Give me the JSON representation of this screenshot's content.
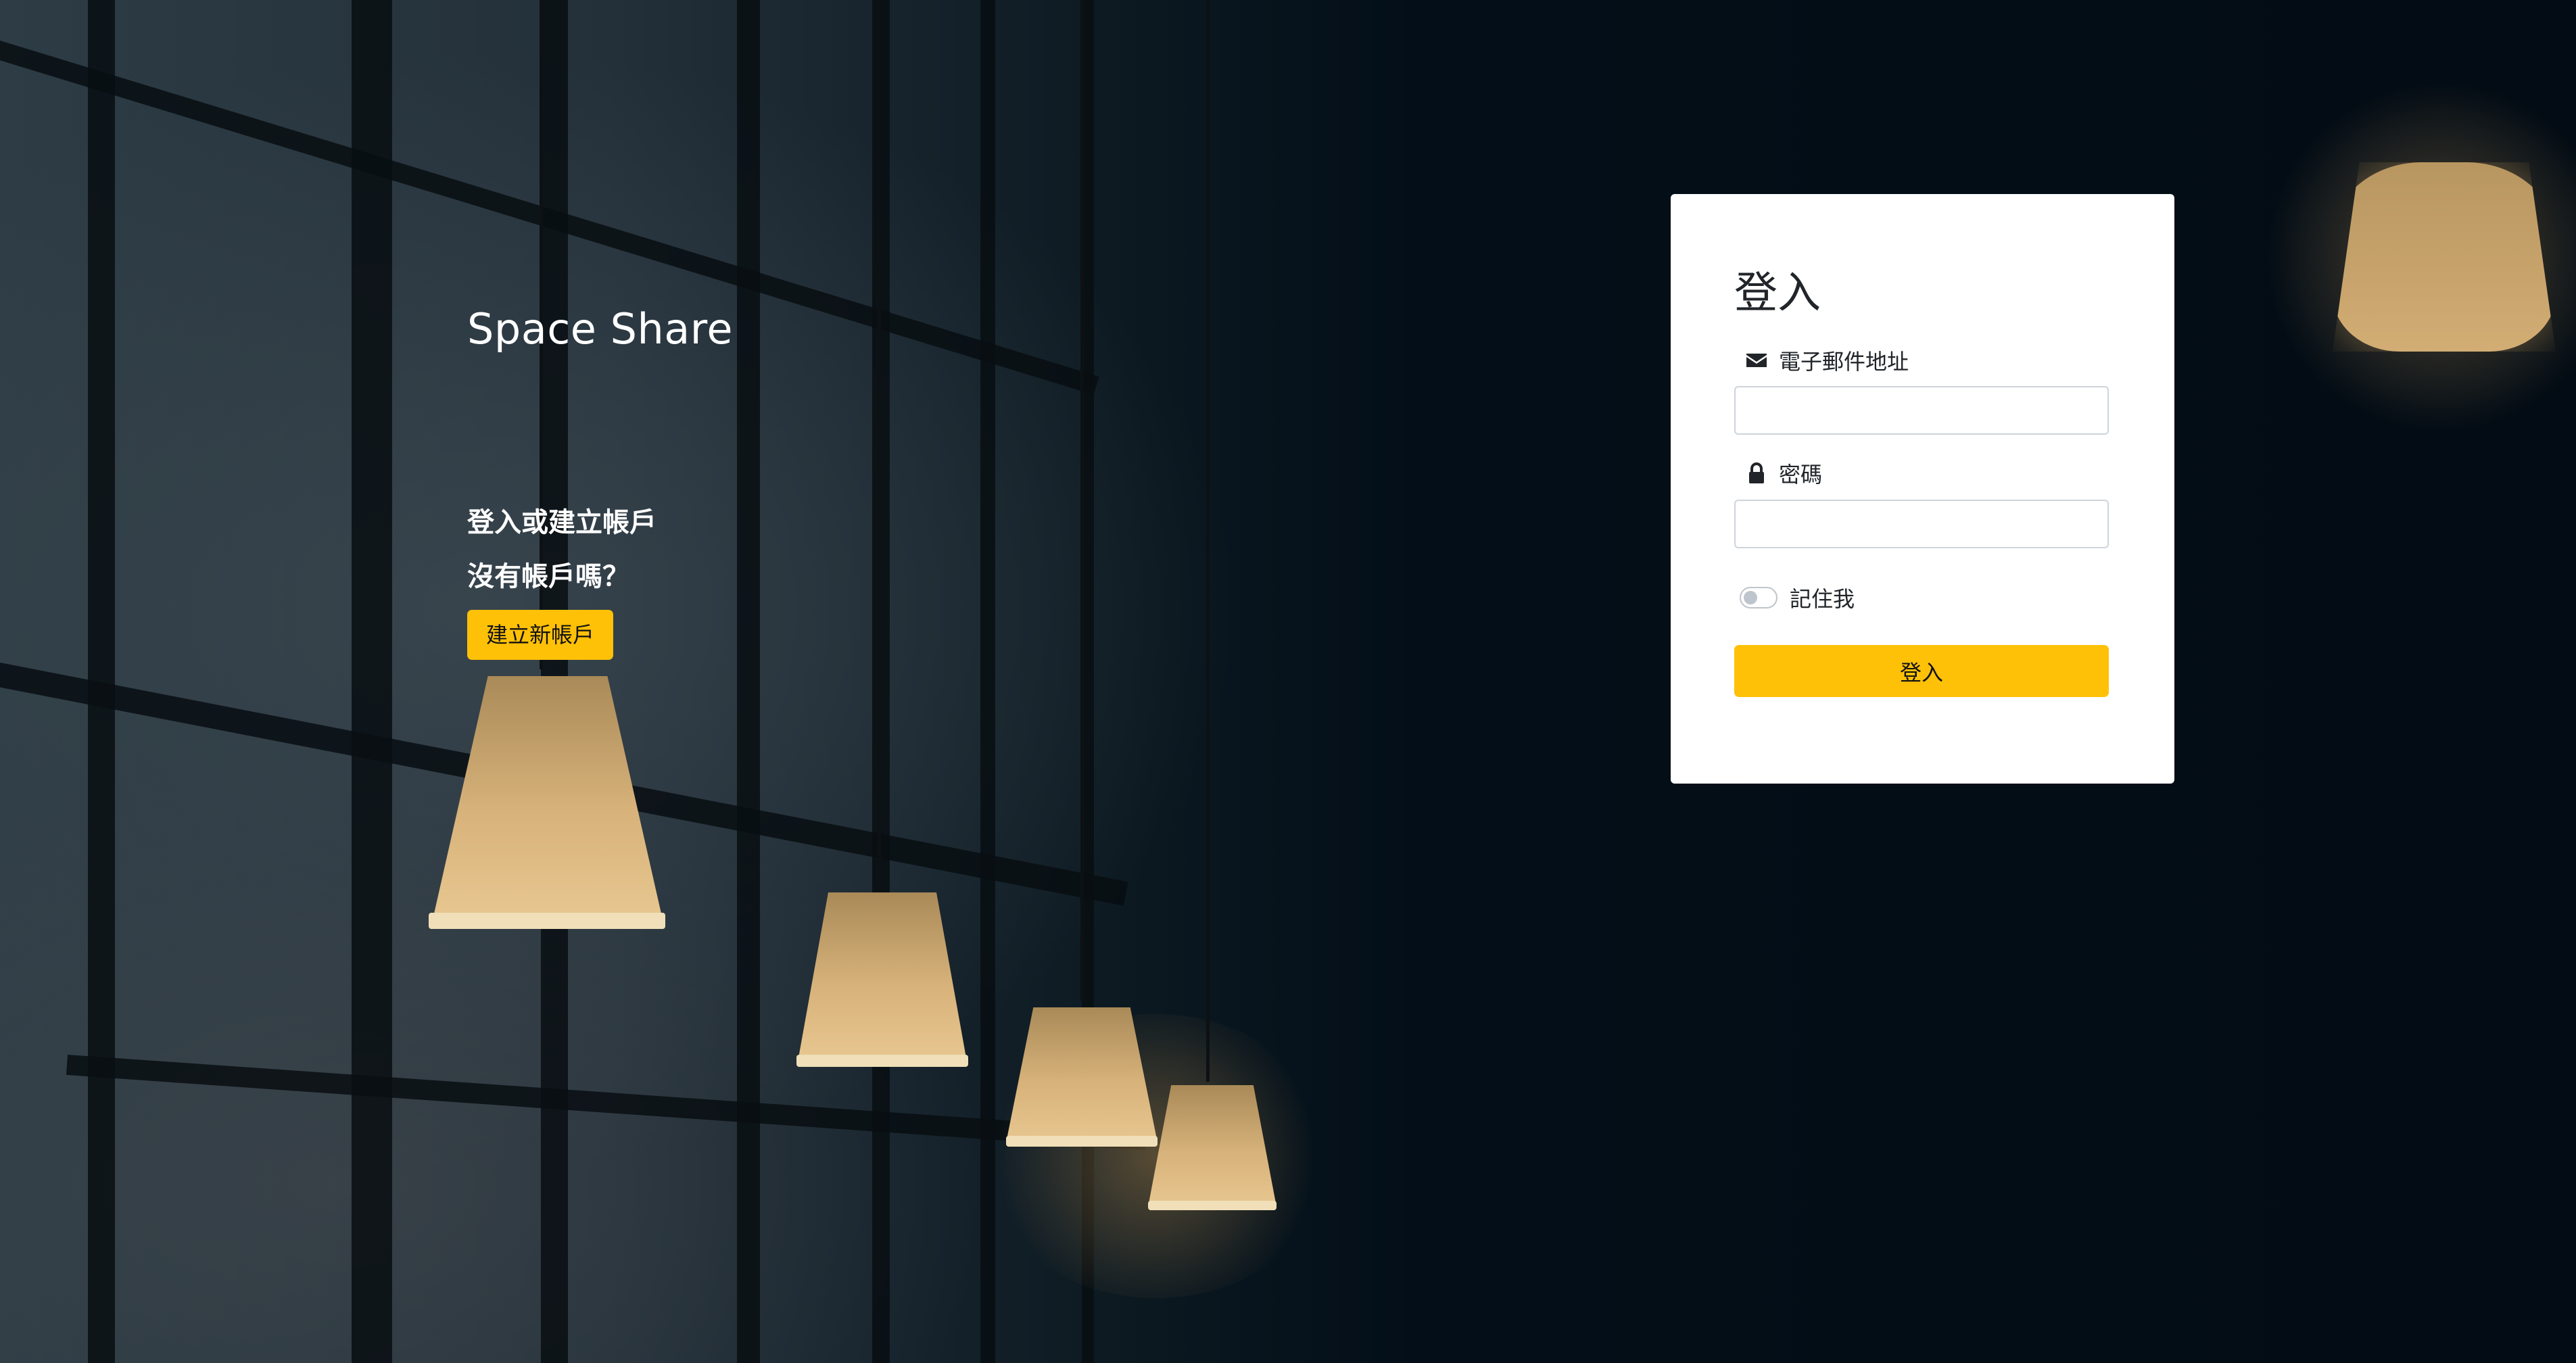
{
  "hero": {
    "brand": "Space Share",
    "tagline": "登入或建立帳戶",
    "no_account": "沒有帳戶嗎？",
    "create_button": "建立新帳戶"
  },
  "login": {
    "title": "登入",
    "email_label": "電子郵件地址",
    "email_value": "",
    "password_label": "密碼",
    "password_value": "",
    "remember_label": "記住我",
    "remember_checked": false,
    "submit_label": "登入"
  },
  "icons": {
    "email": "envelope-icon",
    "password": "lock-icon"
  },
  "colors": {
    "accent": "#ffc107",
    "card_bg": "#ffffff",
    "text": "#212529"
  }
}
